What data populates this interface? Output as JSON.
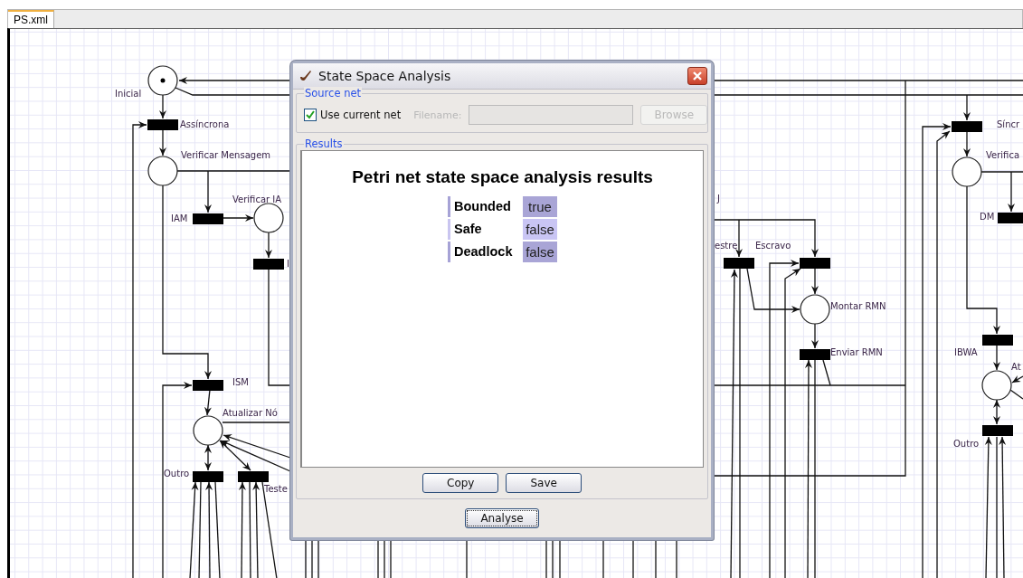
{
  "tabs": [
    {
      "label": "PS.xml",
      "selected": true
    }
  ],
  "net": {
    "places": [
      {
        "label": "Inicial",
        "marked": true
      },
      {
        "label": "Verificar Mensagem",
        "marked": false
      },
      {
        "label": "Verificar IA",
        "marked": false
      },
      {
        "label": "Atualizar Nó",
        "marked": false
      },
      {
        "label": "Montar RMN",
        "marked": false
      },
      {
        "label": "Verifica",
        "marked": false
      },
      {
        "label": "At",
        "marked": false
      }
    ],
    "transitions": [
      {
        "label": "Assíncrona"
      },
      {
        "label": "IAM"
      },
      {
        "label": "I"
      },
      {
        "label": "ISM"
      },
      {
        "label": "Outro"
      },
      {
        "label": "Teste"
      },
      {
        "label": "J"
      },
      {
        "label": "estre"
      },
      {
        "label": "Escravo"
      },
      {
        "label": "Enviar RMN"
      },
      {
        "label": "Síncr"
      },
      {
        "label": "DM"
      },
      {
        "label": "IBWA"
      },
      {
        "label": "Outro"
      }
    ]
  },
  "dialog": {
    "title": "State Space Analysis",
    "source_net": {
      "legend": "Source net",
      "use_current": {
        "label": "Use current net",
        "checked": true
      },
      "filename": {
        "label": "Filename:",
        "disabled": true
      },
      "browse": {
        "label": "Browse",
        "disabled": true
      }
    },
    "results": {
      "legend": "Results",
      "heading": "Petri net state space analysis results",
      "rows": [
        {
          "property": "Bounded",
          "value": "true"
        },
        {
          "property": "Safe",
          "value": "false"
        },
        {
          "property": "Deadlock",
          "value": "false"
        }
      ],
      "buttons": [
        "Copy",
        "Save"
      ]
    },
    "analyse_button": {
      "label": "Analyse",
      "focused": true
    }
  }
}
